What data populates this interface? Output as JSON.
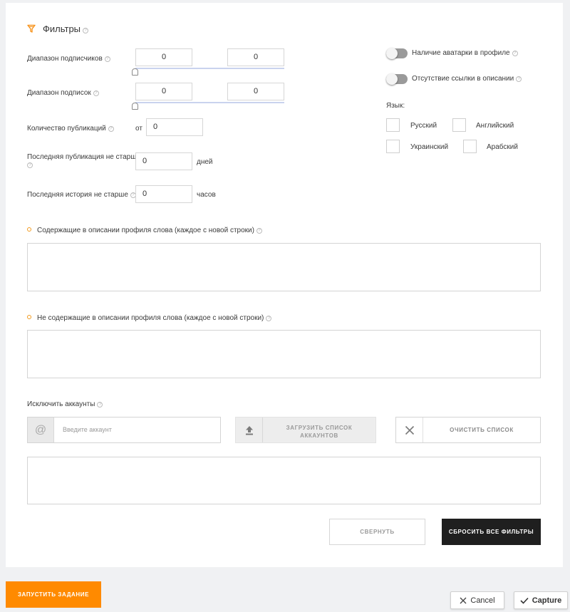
{
  "filters": {
    "title": "Фильтры",
    "subscribers_range": {
      "label": "Диапазон подписчиков",
      "min": "0",
      "max": "0"
    },
    "subscriptions_range": {
      "label": "Диапазон подписок",
      "min": "0",
      "max": "0"
    },
    "publications": {
      "label": "Количество публикаций",
      "prefix": "от",
      "value": "0"
    },
    "last_publication": {
      "label_line1": "Последняя публикация не старше",
      "value": "0",
      "unit": "дней"
    },
    "last_story": {
      "label": "Последняя история не старше",
      "value": "0",
      "unit": "часов"
    },
    "avatar_toggle": {
      "label": "Наличие аватарки в профиле"
    },
    "link_toggle": {
      "label": "Отсутствие ссылки в описании"
    },
    "language": {
      "label": "Язык:",
      "options": [
        "Русский",
        "Английский",
        "Украинский",
        "Арабский"
      ]
    },
    "include_words": {
      "label": "Содержащие в описании профиля слова (каждое с новой строки)",
      "value": ""
    },
    "exclude_words": {
      "label": "Не содержащие в описании профиля слова (каждое с новой строки)",
      "value": ""
    },
    "exclude_accounts": {
      "label": "Исключить аккаунты",
      "input_placeholder": "Введите аккаунт",
      "upload_label_line1": "ЗАГРУЗИТЬ СПИСОК",
      "upload_label_line2": "АККАУНТОВ",
      "clear_label": "ОЧИСТИТЬ СПИСОК",
      "list_value": ""
    },
    "collapse_label": "СВЕРНУТЬ",
    "reset_label": "СБРОСИТЬ ВСЕ ФИЛЬТРЫ"
  },
  "footer": {
    "start_label": "ЗАПУСТИТЬ ЗАДАНИЕ",
    "cancel_label": "Cancel",
    "capture_label": "Capture"
  },
  "colors": {
    "accent": "#ff8a00",
    "funnel": "#f7941d",
    "dark_button": "#1f1f1f",
    "slider_track": "#c9d3ee"
  }
}
